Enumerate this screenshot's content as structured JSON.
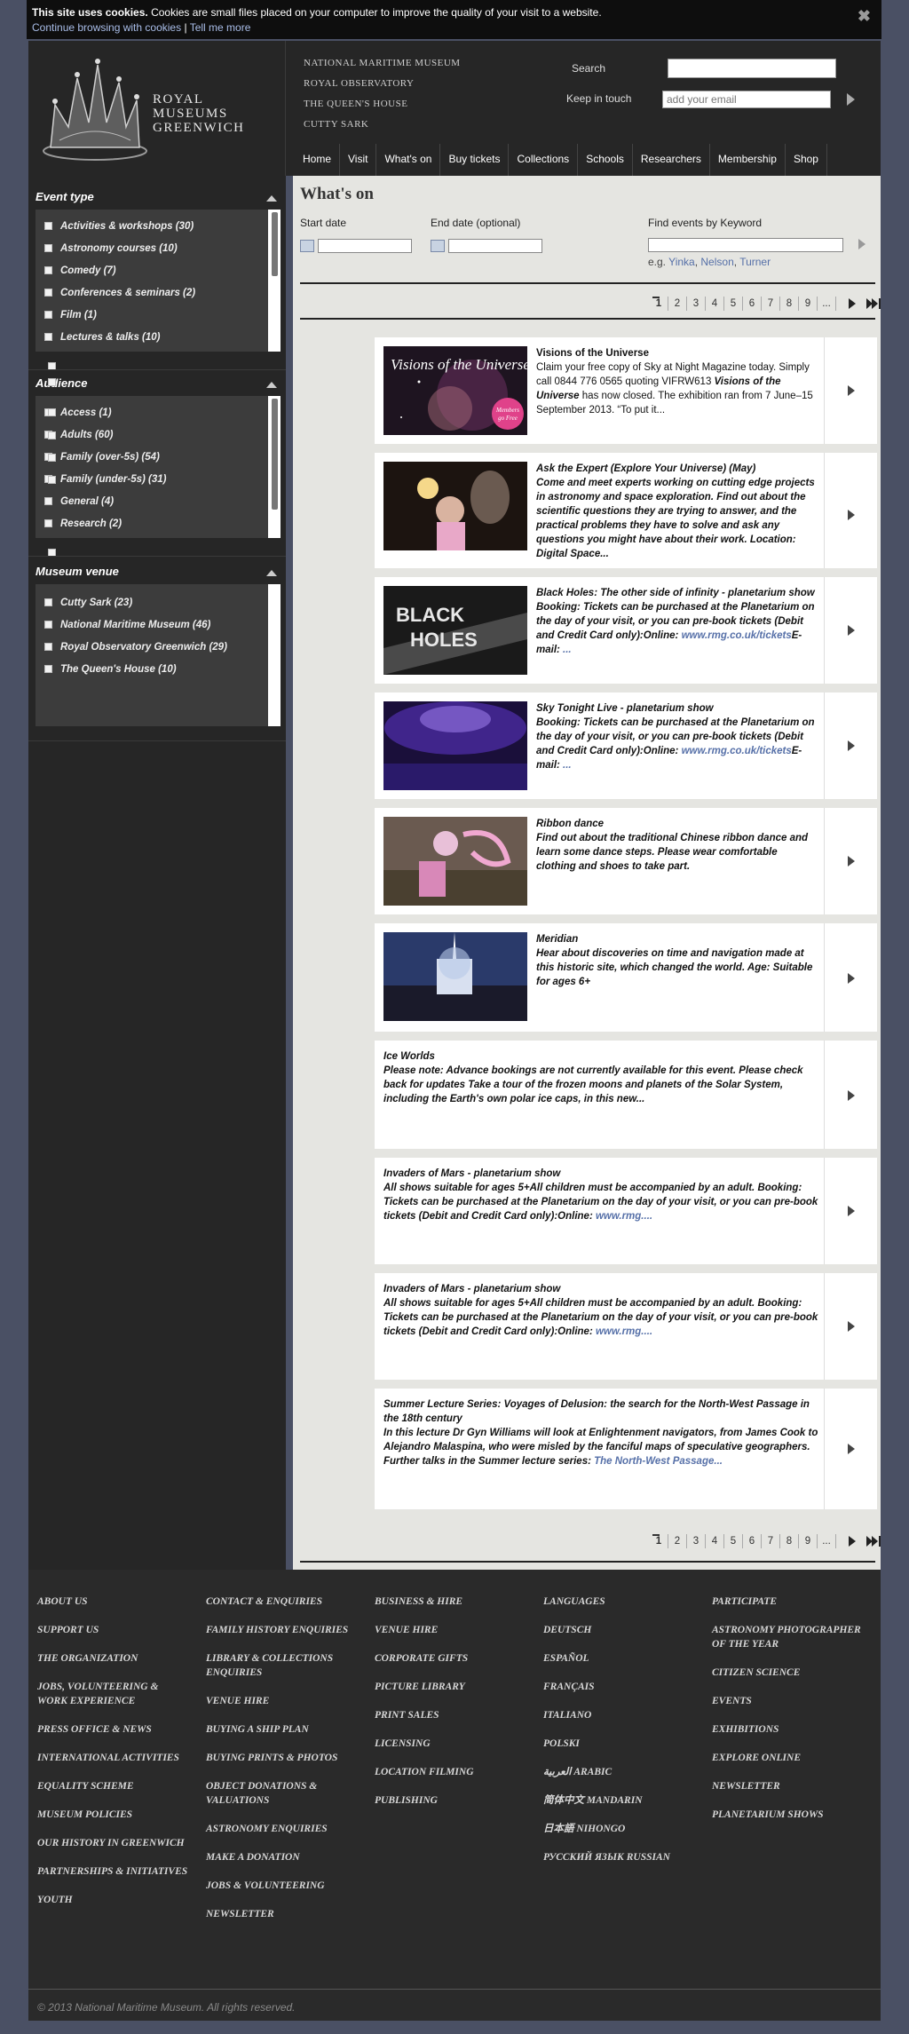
{
  "cookie": {
    "bold": "This site uses cookies.",
    "text": "Cookies are small files placed on your computer to improve the quality of your visit to a website.",
    "continue": "Continue browsing with cookies",
    "sep": "|",
    "tell_more": "Tell me more",
    "close": "✖"
  },
  "header": {
    "logo_lines": [
      "Royal",
      "Museums",
      "Greenwich"
    ],
    "sites": [
      "National Maritime Museum",
      "Royal Observatory",
      "The Queen's House",
      "Cutty Sark"
    ],
    "search_label": "Search",
    "kit_label": "Keep in touch",
    "email_placeholder": "add your email",
    "nav": [
      "Home",
      "Visit",
      "What's on",
      "Buy tickets",
      "Collections",
      "Schools",
      "Researchers",
      "Membership",
      "Shop"
    ]
  },
  "sidebar": {
    "event_type": {
      "title": "Event type",
      "items": [
        "Activities & workshops (30)",
        "Astronomy courses (10)",
        "Comedy (7)",
        "Conferences & seminars (2)",
        "Film (1)",
        "Lectures & talks (10)"
      ]
    },
    "audience": {
      "title": "Audience",
      "items": [
        "Access (1)",
        "Adults (60)",
        "Family (over-5s) (54)",
        "Family (under-5s) (31)",
        "General (4)",
        "Research (2)"
      ]
    },
    "venue": {
      "title": "Museum venue",
      "items": [
        "Cutty Sark (23)",
        "National Maritime Museum (46)",
        "Royal Observatory Greenwich (29)",
        "The Queen's House (10)"
      ]
    }
  },
  "main": {
    "title": "What's on",
    "start_label": "Start date",
    "end_label": "End date (optional)",
    "kw_label": "Find events by Keyword",
    "kw_eg": "e.g.",
    "kw_examples": [
      "Yinka",
      "Nelson",
      "Turner"
    ],
    "pages": [
      "1",
      "2",
      "3",
      "4",
      "5",
      "6",
      "7",
      "8",
      "9",
      "..."
    ],
    "events": [
      {
        "title": "Visions of the Universe",
        "body_a": "Claim your free copy of Sky at Night Magazine today. Simply call 0844 776 0565 quoting VIFRW613 ",
        "body_b": "Visions of the Universe",
        "body_c": " has now closed. The exhibition ran from 7 June–15 September 2013. “To put it...",
        "thumb_title": "Visions of the Universe",
        "thumb_badge": "Members go Free"
      },
      {
        "title": "Ask the Expert (Explore Your Universe) (May)",
        "body": "Come and meet experts working on cutting edge projects in astronomy and space exploration. Find out about the scientific questions they are trying to answer, and the practical problems they have to solve and ask any questions you might have about their work. Location: Digital Space..."
      },
      {
        "title": "Black Holes: The other side of infinity - planetarium show",
        "body": "Booking: Tickets can be purchased at the Planetarium on the day of your visit, or you can pre-book tickets (Debit and Credit Card only):Online: ",
        "link": "www.rmg.co.uk/tickets",
        "tail": "E-mail: ",
        "tail_link": "...",
        "thumb_title": "BLACK HOLES"
      },
      {
        "title": "Sky Tonight Live - planetarium show",
        "body": "Booking: Tickets can be purchased at the Planetarium on the day of your visit, or you can pre-book tickets (Debit and Credit Card only):Online: ",
        "link": "www.rmg.co.uk/tickets",
        "tail": "E-mail: ",
        "tail_link": "..."
      },
      {
        "title": "Ribbon dance",
        "body": "Find out about the traditional Chinese ribbon dance and learn some dance steps. Please wear comfortable clothing and shoes to take part."
      },
      {
        "title": "Meridian",
        "body": "Hear about discoveries on time and navigation made at this historic site, which changed the world. Age: Suitable for ages 6+"
      },
      {
        "title": "Ice Worlds",
        "body": "Please note: Advance bookings are not currently available for this event. Please check back for updates Take a tour of the frozen moons and planets of the Solar System, including the Earth's own polar ice caps, in this new..."
      },
      {
        "title": "Invaders of Mars - planetarium show",
        "body": "All shows suitable for ages 5+All children must be accompanied by an adult. Booking: Tickets can be purchased at the Planetarium on the day of your visit, or you can pre-book tickets (Debit and Credit Card only):Online: ",
        "link": "www.rmg...."
      },
      {
        "title": "Invaders of Mars - planetarium show",
        "body": "All shows suitable for ages 5+All children must be accompanied by an adult. Booking: Tickets can be purchased at the Planetarium on the day of your visit, or you can pre-book tickets (Debit and Credit Card only):Online: ",
        "link": "www.rmg...."
      },
      {
        "title": "Summer Lecture Series: Voyages of Delusion: the search for the North-West Passage in the 18th century",
        "body": "In this lecture Dr Gyn Williams will look at Enlightenment navigators, from James Cook to Alejandro Malaspina, who were misled by the fanciful maps of speculative geographers. Further talks in the Summer lecture series: ",
        "link": "The North-West Passage..."
      }
    ]
  },
  "footer": {
    "col1": [
      "About us",
      "Support us",
      "The organization",
      "Jobs, volunteering & work experience",
      "Press office & news",
      "International activities",
      "Equality scheme",
      "Museum policies",
      "Our history in Greenwich",
      "Partnerships & initiatives",
      "Youth"
    ],
    "col2": [
      "Contact & enquiries",
      "Family history enquiries",
      "Library & collections enquiries",
      "Venue hire",
      "Buying a ship plan",
      "Buying prints & photos",
      "Object donations & valuations",
      "Astronomy enquiries",
      "Make a donation",
      "Jobs & volunteering",
      "Newsletter"
    ],
    "col3": [
      "Business & hire",
      "Venue hire",
      "Corporate gifts",
      "Picture library",
      "Print sales",
      "Licensing",
      "Location filming",
      "Publishing"
    ],
    "col4": [
      "Languages",
      "Deutsch",
      "Español",
      "Français",
      "Italiano",
      "Polski",
      "العربية Arabic",
      "简体中文 Mandarin",
      "日本語 Nihongo",
      "Русский язык Russian"
    ],
    "col5": [
      "Participate",
      "Astronomy Photographer of the Year",
      "Citizen science",
      "Events",
      "Exhibitions",
      "Explore online",
      "Newsletter",
      "Planetarium shows"
    ],
    "copyright": "© 2013 National Maritime Museum. All rights reserved."
  }
}
